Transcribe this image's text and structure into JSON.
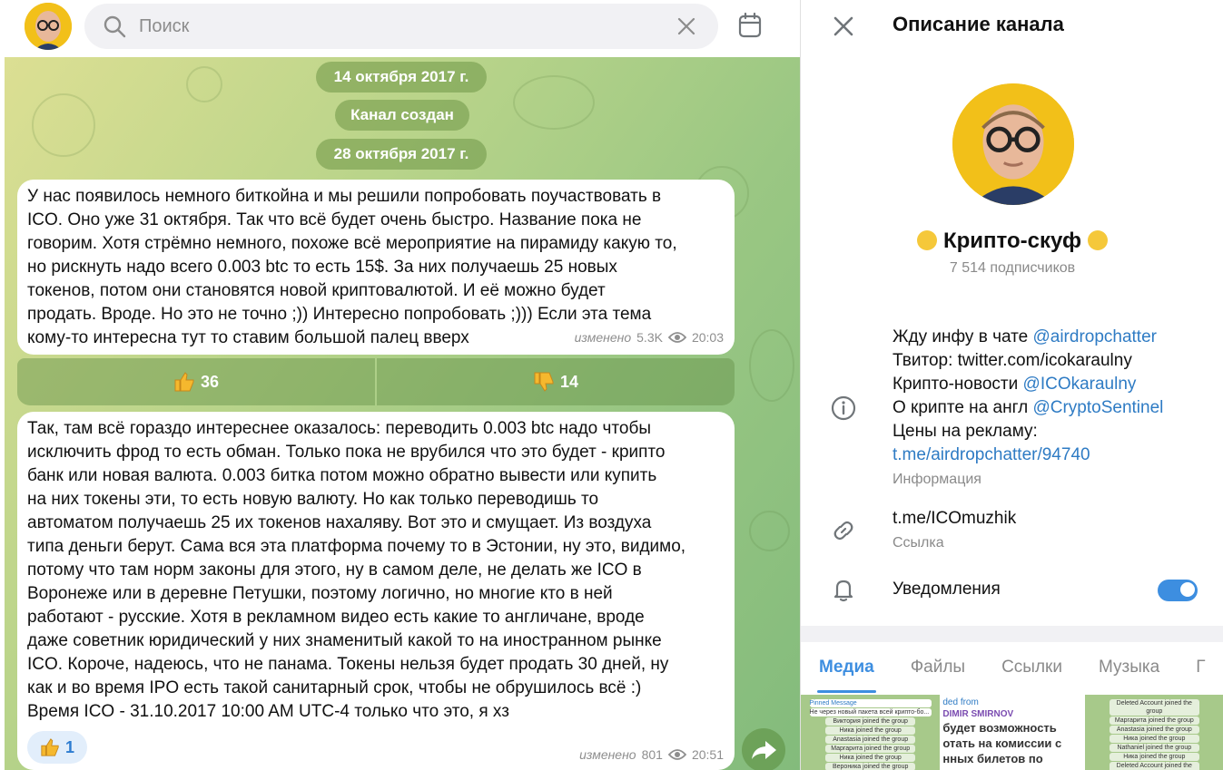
{
  "search": {
    "placeholder": "Поиск"
  },
  "chat": {
    "date_1": "14 октября 2017 г.",
    "service": "Канал создан",
    "date_2": "28 октября 2017 г.",
    "messages": [
      {
        "text": "У нас появилось немного биткойна и мы решили попробовать поучаствовать в\nICO. Оно уже 31 октября. Так что всё будет очень быстро. Название пока не\nговорим. Хотя стрёмно немного, похоже всё мероприятие на пирамиду какую то,\nно рискнуть надо всего 0.003 btc то есть 15$. За них получаешь 25 новых\nтокенов, потом они становятся новой криптовалютой. И её можно будет\nпродать. Вроде. Но это не точно ;)) Интересно попробовать ;))) Если эта тема\nкому-то интересна тут то ставим большой палец вверх",
        "edited": "изменено",
        "views": "5.3K",
        "time": "20:03"
      },
      {
        "text": "Так, там всё гораздо интереснее оказалось: переводить 0.003 btc надо чтобы\nисключить фрод то есть обман. Только пока не врубился что это будет - крипто\nбанк или новая валюта. 0.003 битка потом можно обратно вывести или купить\nна них токены эти, то есть новую валюту. Но как только переводишь то\nавтоматом получаешь 25 их токенов нахаляву. Вот это и смущает. Из воздуха\nтипа деньги берут. Сама вся эта платформа почему то в Эстонии, ну это, видимо,\nпотому что там норм законы для этого, ну в самом деле, не делать же ICO в\nВоронеже или в деревне Петушки, поэтому логично, но многие кто в ней\nработают - русские. Хотя в рекламном видео есть какие то англичане, вроде\nдаже советник юридический у них знаменитый какой то на иностранном рынке\nICO. Короче, надеюсь, что не панама. Токены нельзя будет продать 30 дней, ну\nкак и во время IPO есть такой санитарный срок, чтобы не обрушилось всё :)\nВремя ICO - 31.10.2017 10:00 AM UTC-4 только что это, я хз",
        "edited": "изменено",
        "views": "801",
        "time": "20:51",
        "reaction_count": "1"
      }
    ],
    "buttons": {
      "up_count": "36",
      "down_count": "14"
    }
  },
  "info": {
    "header": "Описание канала",
    "channel_name": "Крипто-скуф",
    "subscribers": "7 514 подписчиков",
    "desc": {
      "l1_text": "Жду инфу в чате ",
      "l1_link": "@airdropchatter",
      "l2_text": "Твитор: twitter.com/icokaraulny",
      "l3_text": "Крипто-новости ",
      "l3_link": "@ICOkaraulny",
      "l4_text": "О крипте на англ ",
      "l4_link": "@CryptoSentinel",
      "l5_text": "Цены на рекламу:",
      "l6_link": "t.me/airdropchatter/94740"
    },
    "desc_label": "Информация",
    "link": "t.me/ICOmuzhik",
    "link_label": "Ссылка",
    "notifications": "Уведомления",
    "notifications_on": true,
    "tabs": [
      "Медиа",
      "Файлы",
      "Ссылки",
      "Музыка",
      "Г"
    ],
    "thumbs": {
      "t1_title": "Pinned Message",
      "t1_sub": "Не через новый пакета всей крипто-бо...",
      "t1_lines": [
        "Виктория joined the group",
        "Ника joined the group",
        "Anastasia joined the group",
        "Маргарита joined the group",
        "Ника joined the group",
        "Вероника joined the group"
      ],
      "t2_lines": [
        "ded from",
        "DIMIR SMIRNOV",
        "будет возможность",
        "отать на комиссии с",
        "нных билетов по промоко"
      ],
      "t3_lines": [
        "Deleted Account joined the group",
        "Маргарита joined the group",
        "Anastasia joined the group",
        "Ника joined the group",
        "Nathaniel joined the group",
        "Ника joined the group",
        "Deleted Account joined the group"
      ]
    }
  },
  "colors": {
    "accent": "#3d8ee0",
    "link": "#2e7bc4",
    "wallpaper_start": "#dcdf93",
    "wallpaper_end": "#83bb7c"
  }
}
